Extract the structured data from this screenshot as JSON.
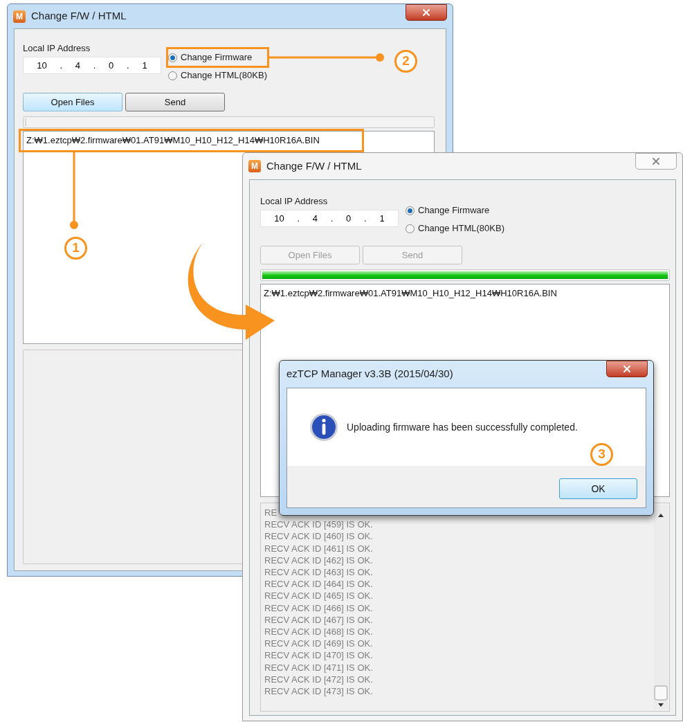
{
  "windows": [
    {
      "title": "Change F/W / HTML",
      "icon_letter": "M",
      "close_active": true,
      "ip_label": "Local IP Address",
      "ip_parts": [
        "10",
        ".",
        "4",
        ".",
        "0",
        ".",
        "1"
      ],
      "modes": [
        {
          "label": "Change Firmware",
          "selected": true
        },
        {
          "label": "Change HTML(80KB)",
          "selected": false
        }
      ],
      "buttons": [
        {
          "label": "Open Files",
          "disabled": false,
          "focused": true
        },
        {
          "label": "Send",
          "disabled": false,
          "focused": false
        }
      ],
      "progress": {
        "level": 0
      },
      "files": [
        "Z:₩1.eztcp₩2.firmware₩01.AT91₩M10_H10_H12_H14₩H10R16A.BIN"
      ]
    },
    {
      "title": "Change F/W / HTML",
      "icon_letter": "M",
      "close_active": false,
      "ip_label": "Local IP Address",
      "ip_parts": [
        "10",
        ".",
        "4",
        ".",
        "0",
        ".",
        "1"
      ],
      "modes": [
        {
          "label": "Change Firmware",
          "selected": true
        },
        {
          "label": "Change HTML(80KB)",
          "selected": false
        }
      ],
      "buttons": [
        {
          "label": "Open Files",
          "disabled": true,
          "focused": false
        },
        {
          "label": "Send",
          "disabled": true,
          "focused": false
        }
      ],
      "progress": {
        "level": 1
      },
      "files": [
        "Z:₩1.eztcp₩2.firmware₩01.AT91₩M10_H10_H12_H14₩H10R16A.BIN"
      ],
      "log": [
        "RE",
        "RECV ACK ID [459] IS OK.",
        "RECV ACK ID [460] IS OK.",
        "RECV ACK ID [461] IS OK.",
        "RECV ACK ID [462] IS OK.",
        "RECV ACK ID [463] IS OK.",
        "RECV ACK ID [464] IS OK.",
        "RECV ACK ID [465] IS OK.",
        "RECV ACK ID [466] IS OK.",
        "RECV ACK ID [467] IS OK.",
        "RECV ACK ID [468] IS OK.",
        "RECV ACK ID [469] IS OK.",
        "RECV ACK ID [470] IS OK.",
        "RECV ACK ID [471] IS OK.",
        "RECV ACK ID [472] IS OK.",
        "RECV ACK ID [473] IS OK."
      ]
    }
  ],
  "dialog": {
    "title": "ezTCP Manager v3.3B (2015/04/30)",
    "message": "Uploading firmware has been successfully completed.",
    "button": "OK"
  },
  "callouts": [
    {
      "number": "1"
    },
    {
      "number": "2"
    },
    {
      "number": "3"
    }
  ]
}
